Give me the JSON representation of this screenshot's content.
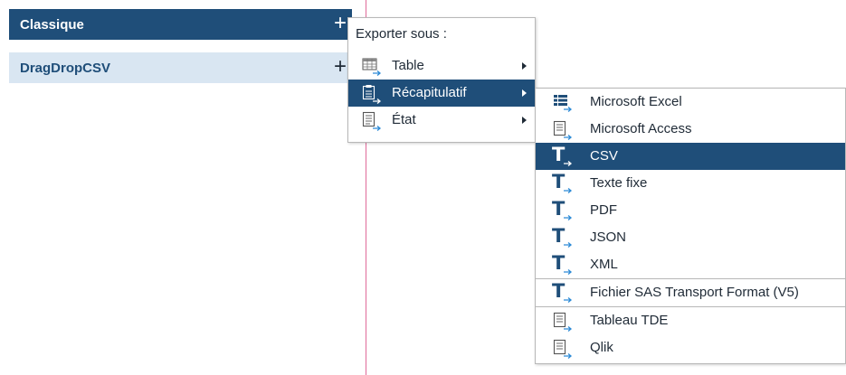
{
  "panel": {
    "rows": [
      {
        "label": "Classique",
        "plus": "+"
      },
      {
        "label": "DragDropCSV",
        "plus": "+"
      }
    ]
  },
  "export_menu": {
    "header": "Exporter sous :",
    "items": [
      {
        "label": "Table",
        "icon": "table-icon"
      },
      {
        "label": "Récapitulatif",
        "icon": "clipboard-export-icon"
      },
      {
        "label": "État",
        "icon": "document-export-icon"
      }
    ]
  },
  "formats_menu": {
    "items": [
      {
        "label": "Microsoft Excel",
        "icon": "excel-export-icon"
      },
      {
        "label": "Microsoft Access",
        "icon": "access-export-icon"
      },
      {
        "label": "CSV",
        "icon": "text-export-icon"
      },
      {
        "label": "Texte fixe",
        "icon": "text-export-icon"
      },
      {
        "label": "PDF",
        "icon": "text-export-icon"
      },
      {
        "label": "JSON",
        "icon": "text-export-icon"
      },
      {
        "label": "XML",
        "icon": "text-export-icon"
      },
      {
        "label": "Fichier SAS Transport Format (V5)",
        "icon": "text-export-icon"
      },
      {
        "label": "Tableau TDE",
        "icon": "document-export-icon"
      },
      {
        "label": "Qlik",
        "icon": "document-export-icon"
      }
    ]
  },
  "colors": {
    "accent": "#1f4e79",
    "panel_light": "#d9e6f2",
    "divider": "#e06a9a",
    "icon_arrow": "#2e8bd6"
  }
}
